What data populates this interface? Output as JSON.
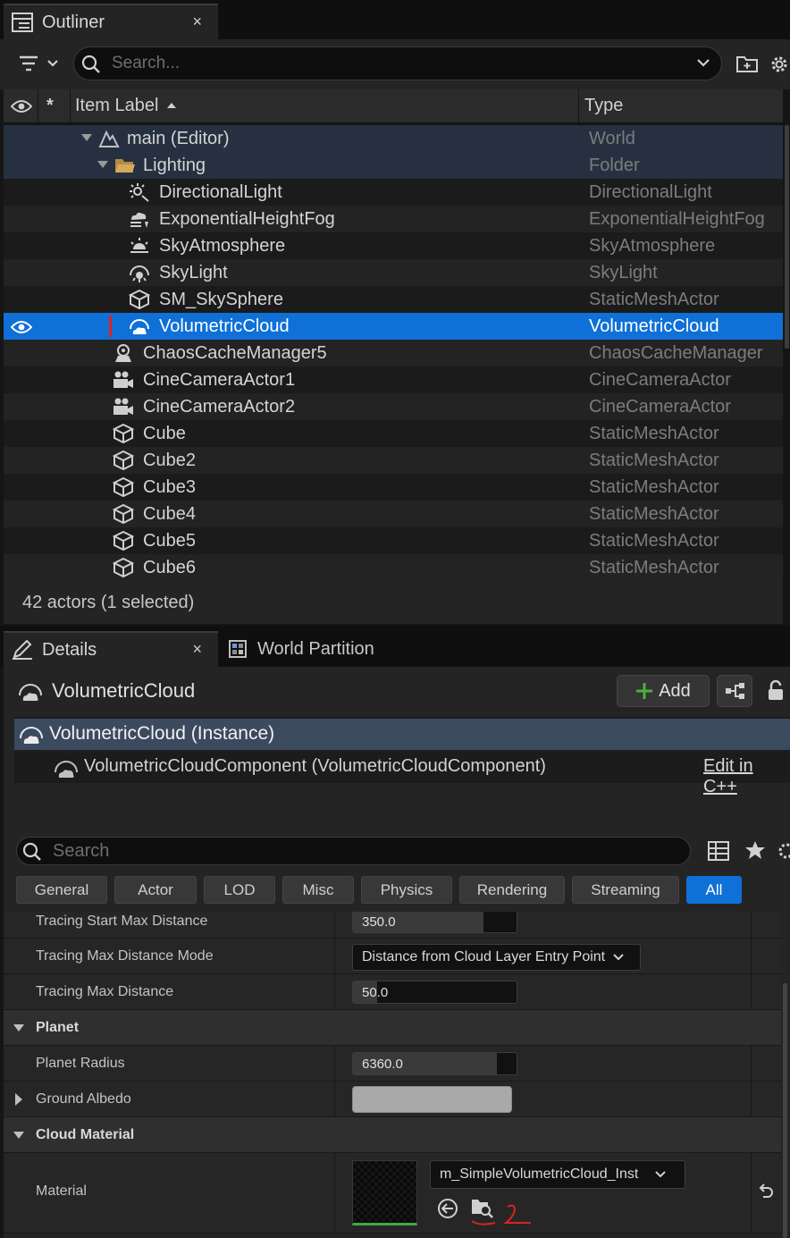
{
  "outliner": {
    "tab_title": "Outliner",
    "tab_close": "×",
    "search_placeholder": "Search...",
    "columns": {
      "star": "*",
      "item_label": "Item Label",
      "type": "Type"
    },
    "rows": [
      {
        "name": "main (Editor)",
        "type": "World",
        "icon": "world-icon"
      },
      {
        "name": "Lighting",
        "type": "Folder",
        "icon": "folder-icon"
      },
      {
        "name": "DirectionalLight",
        "type": "DirectionalLight",
        "icon": "directional-light-icon"
      },
      {
        "name": "ExponentialHeightFog",
        "type": "ExponentialHeightFog",
        "icon": "height-fog-icon"
      },
      {
        "name": "SkyAtmosphere",
        "type": "SkyAtmosphere",
        "icon": "sky-atmosphere-icon"
      },
      {
        "name": "SkyLight",
        "type": "SkyLight",
        "icon": "sky-light-icon"
      },
      {
        "name": "SM_SkySphere",
        "type": "StaticMeshActor",
        "icon": "static-mesh-icon"
      },
      {
        "name": "VolumetricCloud",
        "type": "VolumetricCloud",
        "icon": "volumetric-cloud-icon"
      },
      {
        "name": "ChaosCacheManager5",
        "type": "ChaosCacheManager",
        "icon": "chaos-cache-icon"
      },
      {
        "name": "CineCameraActor1",
        "type": "CineCameraActor",
        "icon": "cine-camera-icon"
      },
      {
        "name": "CineCameraActor2",
        "type": "CineCameraActor",
        "icon": "cine-camera-icon"
      },
      {
        "name": "Cube",
        "type": "StaticMeshActor",
        "icon": "static-mesh-icon"
      },
      {
        "name": "Cube2",
        "type": "StaticMeshActor",
        "icon": "static-mesh-icon"
      },
      {
        "name": "Cube3",
        "type": "StaticMeshActor",
        "icon": "static-mesh-icon"
      },
      {
        "name": "Cube4",
        "type": "StaticMeshActor",
        "icon": "static-mesh-icon"
      },
      {
        "name": "Cube5",
        "type": "StaticMeshActor",
        "icon": "static-mesh-icon"
      },
      {
        "name": "Cube6",
        "type": "StaticMeshActor",
        "icon": "static-mesh-icon"
      }
    ],
    "status": "42 actors (1 selected)"
  },
  "details": {
    "tab_title": "Details",
    "tab_close": "×",
    "tab_world_partition": "World Partition",
    "actor_name": "VolumetricCloud",
    "add_label": "Add",
    "components": [
      {
        "label": "VolumetricCloud (Instance)"
      },
      {
        "label": "VolumetricCloudComponent (VolumetricCloudComponent)"
      }
    ],
    "edit_in_cpp": "Edit in C++",
    "search_placeholder": "Search",
    "filters": [
      "General",
      "Actor",
      "LOD",
      "Misc",
      "Physics",
      "Rendering",
      "Streaming",
      "All"
    ],
    "active_filter": "All",
    "properties": {
      "tracing_start_max_distance": {
        "label": "Tracing Start Max Distance",
        "value": "350.0",
        "fill": 0.8
      },
      "tracing_max_distance_mode": {
        "label": "Tracing Max Distance Mode",
        "value": "Distance from Cloud Layer Entry Point"
      },
      "tracing_max_distance": {
        "label": "Tracing Max Distance",
        "value": "50.0",
        "fill": 0.15
      },
      "planet_category": "Planet",
      "planet_radius": {
        "label": "Planet Radius",
        "value": "6360.0",
        "fill": 0.88
      },
      "ground_albedo": {
        "label": "Ground Albedo",
        "color": "#a9a9a9"
      },
      "cloud_material_category": "Cloud Material",
      "material": {
        "label": "Material",
        "value": "m_SimpleVolumetricCloud_Inst"
      }
    }
  },
  "colors": {
    "selection": "#0f70d7",
    "panel": "#242424",
    "component_highlight": "#3b4a5f"
  }
}
